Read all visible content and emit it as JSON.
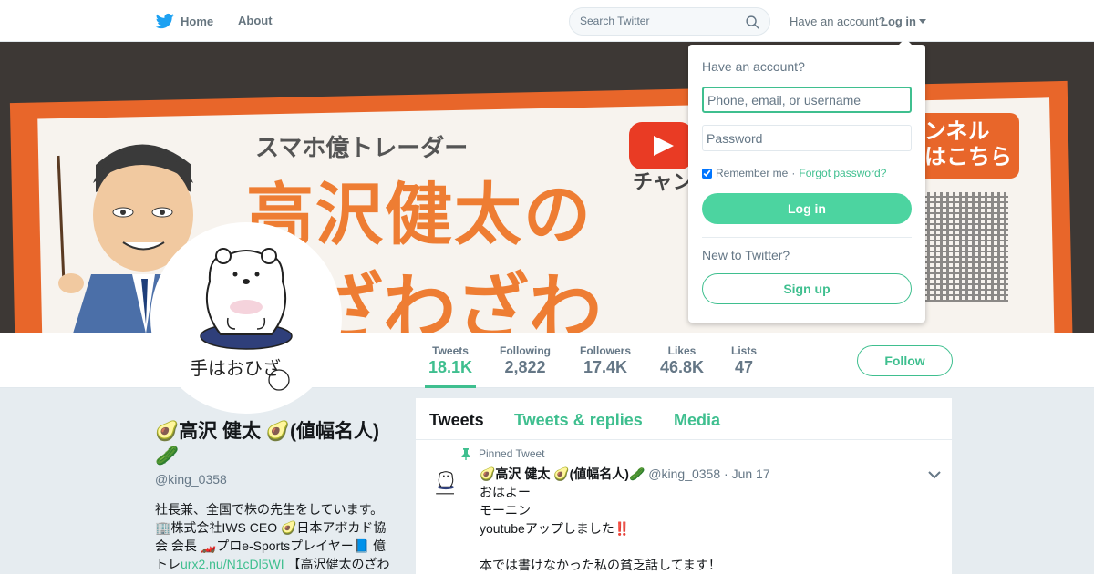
{
  "nav": {
    "home_label": "Home",
    "about_label": "About",
    "search_placeholder": "Search Twitter",
    "have_account": "Have an account?",
    "login_label": "Log in"
  },
  "banner": {
    "subtitle": "スマホ億トレーダー",
    "title_line1": "高沢健太の",
    "title_line2": "ざわざわ",
    "channel_text": "チャン",
    "tag_line1": "ンネル",
    "tag_line2": "はこちら"
  },
  "profile": {
    "name": "🥑高沢 健太 🥑(値幅名人)🥒",
    "screen_name": "@king_0358",
    "bio_text_1": "社長兼、全国で株の先生をしています。🏢株式会社IWS CEO 🥑日本アボカド協会 会長 🏎️プロe-Sportsプレイヤー📘 億トレ",
    "bio_link": "urx2.nu/N1cDl5WI",
    "bio_text_2": "【高沢健太のざわ",
    "avatar_caption": "手はおひざ"
  },
  "stats": {
    "tweets_label": "Tweets",
    "tweets_value": "18.1K",
    "following_label": "Following",
    "following_value": "2,822",
    "followers_label": "Followers",
    "followers_value": "17.4K",
    "likes_label": "Likes",
    "likes_value": "46.8K",
    "lists_label": "Lists",
    "lists_value": "47",
    "follow_label": "Follow"
  },
  "timeline": {
    "tabs": [
      {
        "label": "Tweets"
      },
      {
        "label": "Tweets & replies"
      },
      {
        "label": "Media"
      }
    ],
    "pinned_label": "Pinned Tweet",
    "tweet": {
      "fullname": "🥑高沢 健太 🥑(値幅名人)🥒",
      "handle": "@king_0358",
      "time": "Jun 17",
      "lines": [
        "おはよー",
        "モーニン",
        "youtubeアップしました",
        "",
        "本では書けなかった私の貧乏話してます！"
      ],
      "exclamation": "‼️"
    }
  },
  "login_dropdown": {
    "heading": "Have an account?",
    "user_placeholder": "Phone, email, or username",
    "password_placeholder": "Password",
    "remember_label": "Remember me",
    "separator": "·",
    "forgot_label": "Forgot password?",
    "login_button": "Log in",
    "new_label": "New to Twitter?",
    "signup_button": "Sign up"
  },
  "colors": {
    "accent": "#3fbf8f",
    "twitter_blue": "#1da1f2",
    "banner_orange": "#ee7d33"
  }
}
